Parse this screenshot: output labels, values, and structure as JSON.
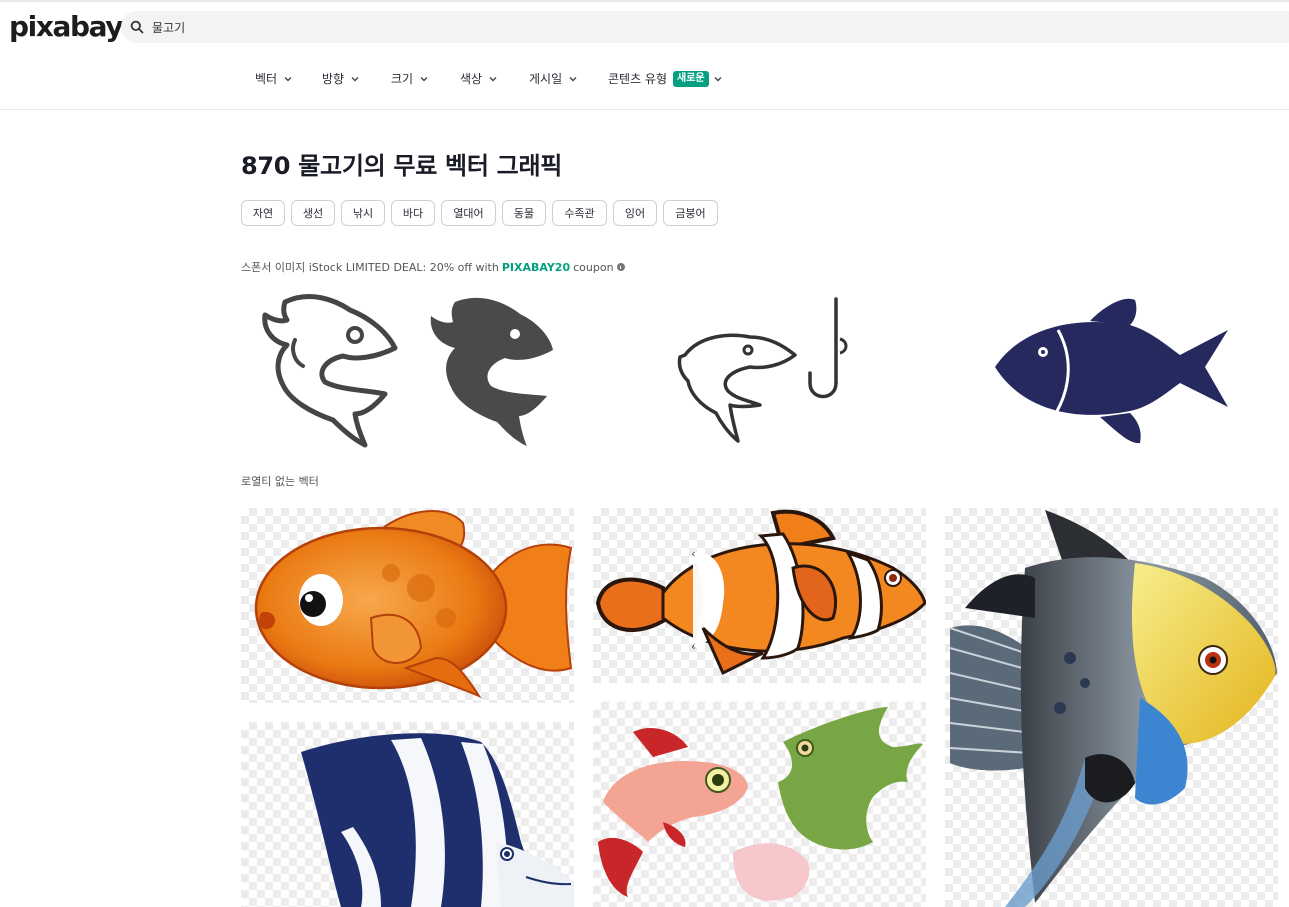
{
  "header": {
    "logo": "pixabay",
    "search": {
      "value": "물고기",
      "icon": "search-icon"
    }
  },
  "filters": [
    {
      "label": "벡터"
    },
    {
      "label": "방향"
    },
    {
      "label": "크기"
    },
    {
      "label": "색상"
    },
    {
      "label": "게시일"
    },
    {
      "label": "콘텐츠 유형",
      "badge": "새로운"
    }
  ],
  "main": {
    "title": "870 물고기의 무료 벡터 그래픽",
    "tags": [
      "자연",
      "생선",
      "낚시",
      "바다",
      "열대어",
      "동물",
      "수족관",
      "잉어",
      "금붕어"
    ],
    "sponsor": {
      "prefix": "스폰서 이미지 iStock LIMITED DEAL: 20% off with",
      "code": "PIXABAY20",
      "suffix": "coupon"
    },
    "royalty_label": "로열티 없는 벡터"
  },
  "sponsor_images": [
    {
      "name": "fish-outline-icon"
    },
    {
      "name": "fish-solid-icon"
    },
    {
      "name": "fish-hook-icon"
    },
    {
      "name": "navy-fish-icon"
    }
  ],
  "results": [
    {
      "name": "goldfish-vector"
    },
    {
      "name": "clownfish-vector"
    },
    {
      "name": "angelfish-vector"
    },
    {
      "name": "striped-angelfish-vector"
    },
    {
      "name": "pink-green-fish-vector"
    }
  ],
  "colors": {
    "accent": "#05a081",
    "navy": "#25295e",
    "icon_gray": "#4a4a4a"
  }
}
